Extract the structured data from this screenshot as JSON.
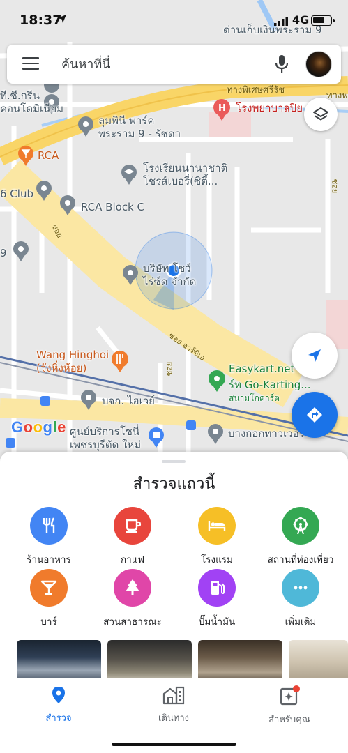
{
  "status_bar": {
    "time": "18:37",
    "network": "4G"
  },
  "search": {
    "placeholder": "ค้นหาที่นี่"
  },
  "map": {
    "pois": {
      "toll": "ด่านเก็บเงินพระราม 9",
      "highway": "ทางพิเศษศรีรัช",
      "highway2": "ทางพ",
      "hospital": "โรงพยาบาลปิย",
      "tgreen": "ที.ซี.กรีน\nคอนโดมิเนียม",
      "lumpini": "ลุมพินี พาร์ค\nพระราม 9 - รัชดา",
      "rca": "RCA",
      "school": "โรงเรียนนานาชาติ\nโชรส์เบอรี่(ซิตี้...",
      "club": "6 Club",
      "rcablock": "RCA Block C",
      "nine": "9",
      "company": "บริษัท โชว์\nไร่ซ์ด จำกัด",
      "soi1": "ซอย",
      "soi2": "ซอย",
      "soi3": "ซอย",
      "soi_artit": "ซอย อาร์ซิเอ",
      "wang": "Wang Hinghoi\n(วังหิ่งห้อย)",
      "easykart": "Easykart.net",
      "gokart": "ร์ท Go-Karting...",
      "gokart_sub": "สนามโกคาร์ต",
      "highway_co": "บจก. ไฮเวย์",
      "service": "ศูนย์บริการโชนี่\nเพชรบุรีตัด ใหม่",
      "bangkok": "บางกอกทาวเวอร์"
    }
  },
  "logo": {
    "text": "Google"
  },
  "sheet": {
    "title": "สำรวจแถวนี้",
    "categories": [
      {
        "label": "ร้านอาหาร",
        "icon": "restaurant-icon",
        "color": "#4285f4"
      },
      {
        "label": "กาแฟ",
        "icon": "coffee-icon",
        "color": "#e8453c"
      },
      {
        "label": "โรงแรม",
        "icon": "hotel-icon",
        "color": "#f6bf26"
      },
      {
        "label": "สถานที่ท่องเที่ยว",
        "icon": "attraction-icon",
        "color": "#34a853"
      },
      {
        "label": "บาร์",
        "icon": "bar-icon",
        "color": "#f07b2c"
      },
      {
        "label": "สวนสาธารณะ",
        "icon": "park-icon",
        "color": "#e046a8"
      },
      {
        "label": "ปั๊มน้ำมัน",
        "icon": "gas-station-icon",
        "color": "#a142f4"
      },
      {
        "label": "เพิ่มเติม",
        "icon": "more-icon",
        "color": "#4fb8d8"
      }
    ]
  },
  "bottom_nav": {
    "items": [
      {
        "label": "สำรวจ",
        "icon": "explore-pin-icon",
        "active": true
      },
      {
        "label": "เดินทาง",
        "icon": "commute-icon",
        "active": false
      },
      {
        "label": "สำหรับคุณ",
        "icon": "for-you-icon",
        "active": false
      }
    ]
  },
  "colors": {
    "accent": "#1a73e8",
    "highway": "#f9d567",
    "notification": "#ea4335"
  }
}
